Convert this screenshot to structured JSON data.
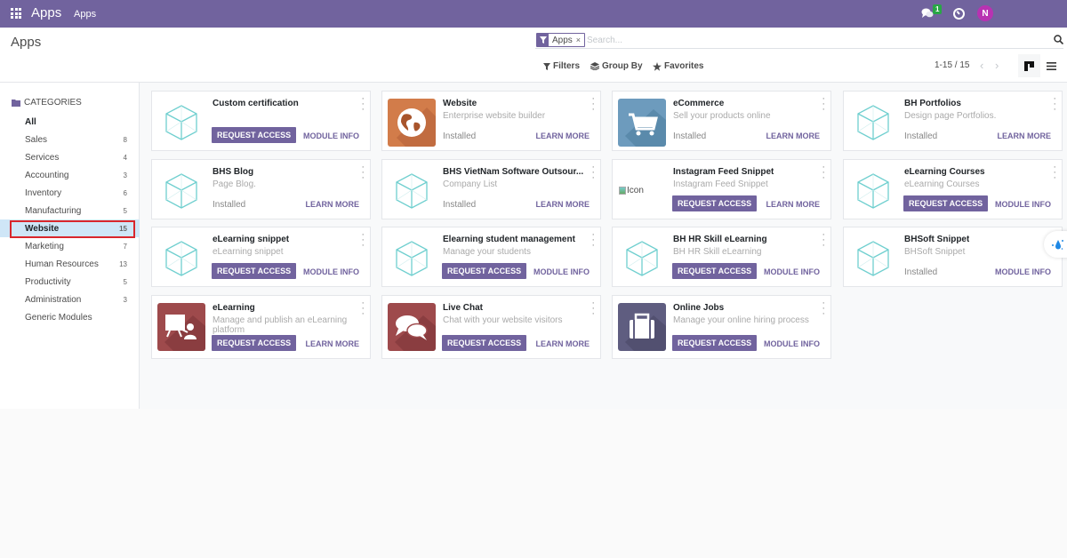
{
  "navbar": {
    "brand": "Apps",
    "menu": "Apps",
    "chat_badge": "1",
    "avatar_initial": "N",
    "icons": {
      "apps": "apps-grid-icon",
      "chat": "chat-icon",
      "activity": "clock-icon"
    }
  },
  "control_panel": {
    "title": "Apps",
    "facet_label": "Apps",
    "facet_close": "×",
    "search_placeholder": "Search...",
    "filters_label": "Filters",
    "group_by_label": "Group By",
    "favorites_label": "Favorites",
    "pager": "1-15 / 15",
    "pager_prev": "‹",
    "pager_next": "›"
  },
  "sidebar": {
    "header": "CATEGORIES",
    "items": [
      {
        "label": "All",
        "count": ""
      },
      {
        "label": "Sales",
        "count": "8"
      },
      {
        "label": "Services",
        "count": "4"
      },
      {
        "label": "Accounting",
        "count": "3"
      },
      {
        "label": "Inventory",
        "count": "6"
      },
      {
        "label": "Manufacturing",
        "count": "5"
      },
      {
        "label": "Website",
        "count": "15"
      },
      {
        "label": "Marketing",
        "count": "7"
      },
      {
        "label": "Human Resources",
        "count": "13"
      },
      {
        "label": "Productivity",
        "count": "5"
      },
      {
        "label": "Administration",
        "count": "3"
      },
      {
        "label": "Generic Modules",
        "count": ""
      }
    ],
    "selected": "Website"
  },
  "cards": [
    {
      "name": "Custom certification",
      "summary": "",
      "status": "",
      "action": "REQUEST ACCESS",
      "link": "MODULE INFO",
      "icon": "cube-icon"
    },
    {
      "name": "Website",
      "summary": "Enterprise website builder",
      "status": "Installed",
      "action": "",
      "link": "LEARN MORE",
      "icon": "globe-icon",
      "icon_color": "#d27c4a"
    },
    {
      "name": "eCommerce",
      "summary": "Sell your products online",
      "status": "Installed",
      "action": "",
      "link": "LEARN MORE",
      "icon": "cart-icon",
      "icon_color": "#6d9bbd"
    },
    {
      "name": "BH Portfolios",
      "summary": "Design page Portfolios.",
      "status": "Installed",
      "action": "",
      "link": "LEARN MORE",
      "icon": "cube-icon"
    },
    {
      "name": "BHS Blog",
      "summary": "Page Blog.",
      "status": "Installed",
      "action": "",
      "link": "LEARN MORE",
      "icon": "cube-icon"
    },
    {
      "name": "BHS VietNam Software Outsour...",
      "summary": "Company List",
      "status": "Installed",
      "action": "",
      "link": "LEARN MORE",
      "icon": "cube-icon"
    },
    {
      "name": "Instagram Feed Snippet",
      "summary": "Instagram Feed Snippet",
      "status": "",
      "action": "REQUEST ACCESS",
      "link": "LEARN MORE",
      "icon": "broken-image-icon",
      "broken_alt": "Icon"
    },
    {
      "name": "eLearning Courses",
      "summary": "eLearning Courses",
      "status": "",
      "action": "REQUEST ACCESS",
      "link": "MODULE INFO",
      "icon": "cube-icon"
    },
    {
      "name": "eLearning snippet",
      "summary": "eLearning snippet",
      "status": "",
      "action": "REQUEST ACCESS",
      "link": "MODULE INFO",
      "icon": "cube-icon"
    },
    {
      "name": "Elearning student management",
      "summary": "Manage your students",
      "status": "",
      "action": "REQUEST ACCESS",
      "link": "MODULE INFO",
      "icon": "cube-icon"
    },
    {
      "name": "BH HR Skill eLearning",
      "summary": "BH HR Skill eLearning",
      "status": "",
      "action": "REQUEST ACCESS",
      "link": "MODULE INFO",
      "icon": "cube-icon"
    },
    {
      "name": "BHSoft Snippet",
      "summary": "BHSoft Snippet",
      "status": "Installed",
      "action": "",
      "link": "MODULE INFO",
      "icon": "cube-icon"
    },
    {
      "name": "eLearning",
      "summary": "Manage and publish an eLearning platform",
      "status": "",
      "action": "REQUEST ACCESS",
      "link": "LEARN MORE",
      "icon": "presentation-icon",
      "icon_color": "#9e4a4c"
    },
    {
      "name": "Live Chat",
      "summary": "Chat with your website visitors",
      "status": "",
      "action": "REQUEST ACCESS",
      "link": "LEARN MORE",
      "icon": "chat-bubbles-icon",
      "icon_color": "#9e4a4c"
    },
    {
      "name": "Online Jobs",
      "summary": "Manage your online hiring process",
      "status": "",
      "action": "REQUEST ACCESS",
      "link": "MODULE INFO",
      "icon": "briefcase-icon",
      "icon_color": "#5f5d80"
    }
  ],
  "colors": {
    "brand": "#71639e",
    "selected_category": "#cfe6f7",
    "highlight": "#d9262c",
    "badge": "#28a745",
    "avatar": "#b832b2"
  }
}
